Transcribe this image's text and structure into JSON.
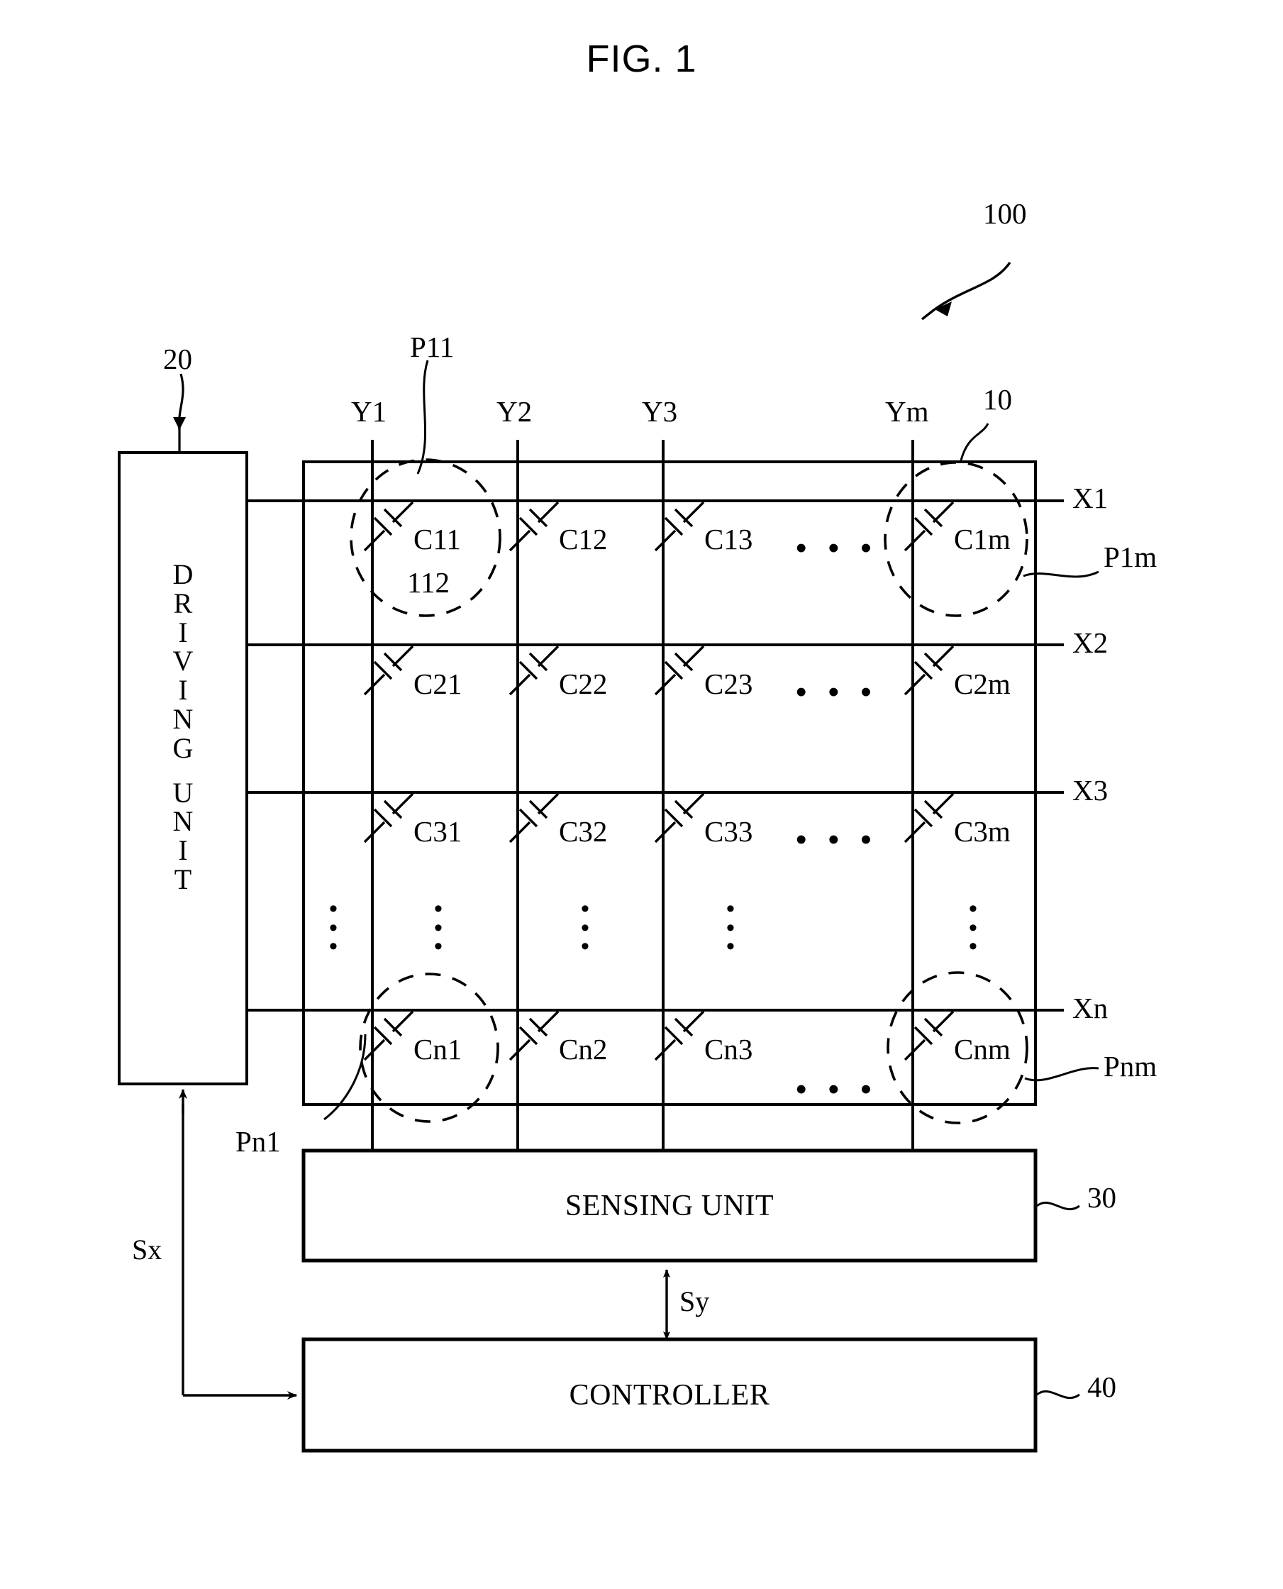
{
  "figure": {
    "title": "FIG. 1",
    "reference_numerals": {
      "system": "100",
      "panel": "10",
      "driving_unit": "20",
      "sensing_unit": "30",
      "controller": "40",
      "capacitor_detail": "112"
    }
  },
  "blocks": {
    "driving_unit": {
      "label": "DRIVING UNIT",
      "letters": [
        "D",
        "R",
        "I",
        "V",
        "I",
        "N",
        "G",
        "",
        "U",
        "N",
        "I",
        "T"
      ],
      "ref": "20"
    },
    "sensing_unit": {
      "label": "SENSING UNIT",
      "ref": "30"
    },
    "controller": {
      "label": "CONTROLLER",
      "ref": "40"
    },
    "panel": {
      "ref": "10"
    }
  },
  "signals": {
    "sx": "Sx",
    "sy": "Sy"
  },
  "drive_lines": {
    "rows_title": "X lines",
    "rows": [
      "X1",
      "X2",
      "X3",
      "Xn"
    ],
    "cols_title": "Y lines",
    "cols": [
      "Y1",
      "Y2",
      "Y3",
      "Ym"
    ]
  },
  "sensor_cells": {
    "row1": [
      "C11",
      "C12",
      "C13",
      "C1m"
    ],
    "row2": [
      "C21",
      "C22",
      "C23",
      "C2m"
    ],
    "row3": [
      "C31",
      "C32",
      "C33",
      "C3m"
    ],
    "rown": [
      "Cn1",
      "Cn2",
      "Cn3",
      "Cnm"
    ]
  },
  "sensor_pixels": {
    "p11": "P11",
    "p1m": "P1m",
    "pn1": "Pn1",
    "pnm": "Pnm"
  },
  "ellipsis": {
    "horizontal": "• • •",
    "vertical_dot": "•"
  }
}
